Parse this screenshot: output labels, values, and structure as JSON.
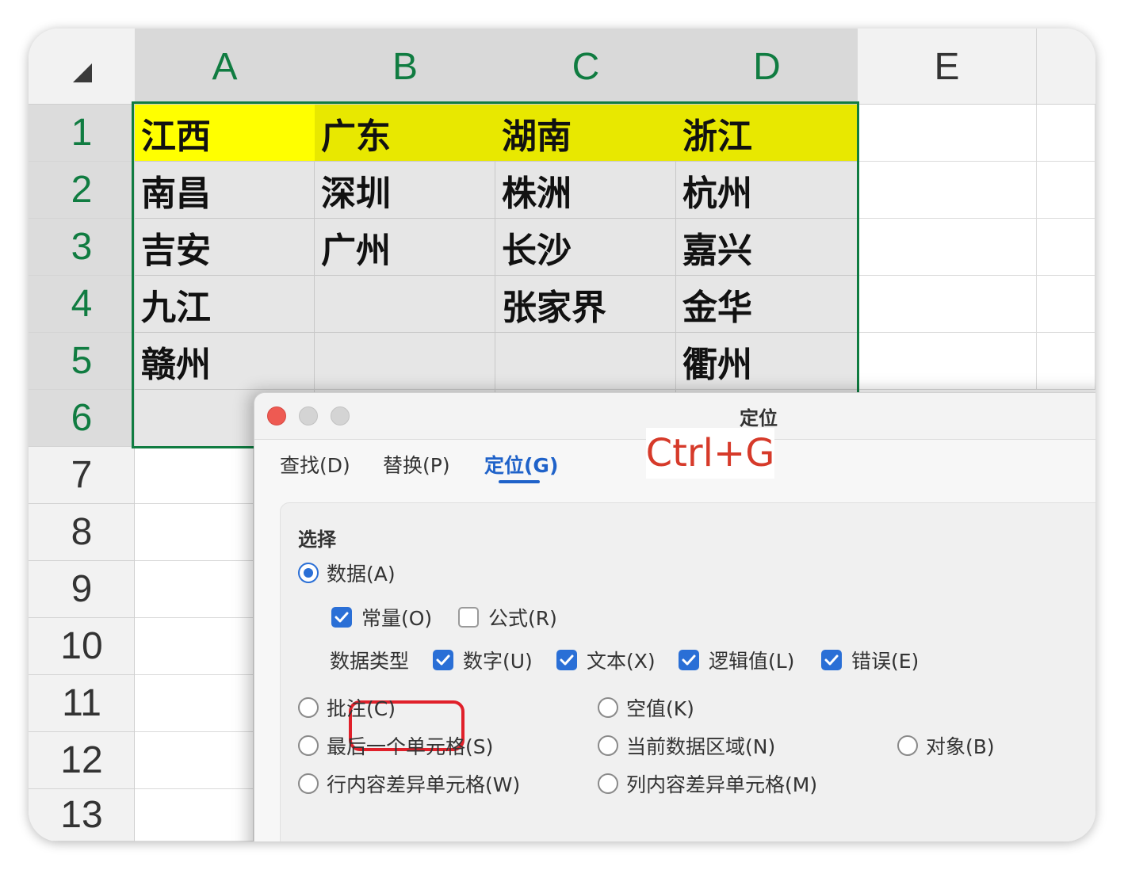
{
  "sheet": {
    "columns": [
      "A",
      "B",
      "C",
      "D",
      "E"
    ],
    "rows": [
      "1",
      "2",
      "3",
      "4",
      "5",
      "6",
      "7",
      "8",
      "9",
      "10",
      "11",
      "12",
      "13"
    ],
    "cells": [
      [
        "江西",
        "广东",
        "湖南",
        "浙江"
      ],
      [
        "南昌",
        "深圳",
        "株洲",
        "杭州"
      ],
      [
        "吉安",
        "广州",
        "长沙",
        "嘉兴"
      ],
      [
        "九江",
        "",
        "张家界",
        "金华"
      ],
      [
        "赣州",
        "",
        "",
        "衢州"
      ]
    ],
    "colors": {
      "selection": "#107c41",
      "header_row_highlight": "#ffff00"
    }
  },
  "dialog": {
    "title": "定位",
    "shortcut_note": "Ctrl+G",
    "tabs": [
      "查找(D)",
      "替换(P)",
      "定位(G)"
    ],
    "active_tab": "定位(G)",
    "section_label": "选择",
    "data_option": "数据(A)",
    "constant_option": "常量(O)",
    "formula_option": "公式(R)",
    "data_type_label": "数据类型",
    "data_types": [
      "数字(U)",
      "文本(X)",
      "逻辑值(L)",
      "错误(E)"
    ],
    "options": {
      "comment": "批注(C)",
      "blank": "空值(K)",
      "last_cell": "最后一个单元格(S)",
      "current_region": "当前数据区域(N)",
      "object": "对象(B)",
      "row_diff": "行内容差异单元格(W)",
      "col_diff": "列内容差异单元格(M)"
    },
    "accent_color": "#2a6fd6"
  }
}
